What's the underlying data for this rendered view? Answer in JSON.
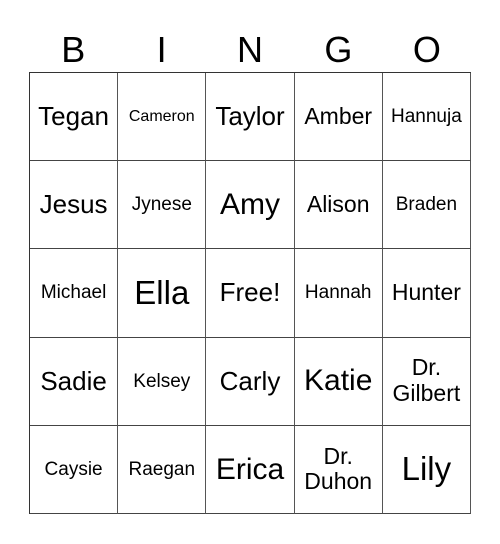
{
  "header": [
    "B",
    "I",
    "N",
    "G",
    "O"
  ],
  "cells": [
    {
      "text": "Tegan",
      "size": "lg"
    },
    {
      "text": "Cameron",
      "size": "xs"
    },
    {
      "text": "Taylor",
      "size": "lg"
    },
    {
      "text": "Amber",
      "size": "md"
    },
    {
      "text": "Hannuja",
      "size": "sm"
    },
    {
      "text": "Jesus",
      "size": "lg"
    },
    {
      "text": "Jynese",
      "size": "sm"
    },
    {
      "text": "Amy",
      "size": "xl"
    },
    {
      "text": "Alison",
      "size": "md"
    },
    {
      "text": "Braden",
      "size": "sm"
    },
    {
      "text": "Michael",
      "size": "sm"
    },
    {
      "text": "Ella",
      "size": "xxl"
    },
    {
      "text": "Free!",
      "size": "lg"
    },
    {
      "text": "Hannah",
      "size": "sm"
    },
    {
      "text": "Hunter",
      "size": "md"
    },
    {
      "text": "Sadie",
      "size": "lg"
    },
    {
      "text": "Kelsey",
      "size": "sm"
    },
    {
      "text": "Carly",
      "size": "lg"
    },
    {
      "text": "Katie",
      "size": "xl"
    },
    {
      "text": "Dr.\nGilbert",
      "size": "md"
    },
    {
      "text": "Caysie",
      "size": "sm"
    },
    {
      "text": "Raegan",
      "size": "sm"
    },
    {
      "text": "Erica",
      "size": "xl"
    },
    {
      "text": "Dr.\nDuhon",
      "size": "md"
    },
    {
      "text": "Lily",
      "size": "xxl"
    }
  ]
}
